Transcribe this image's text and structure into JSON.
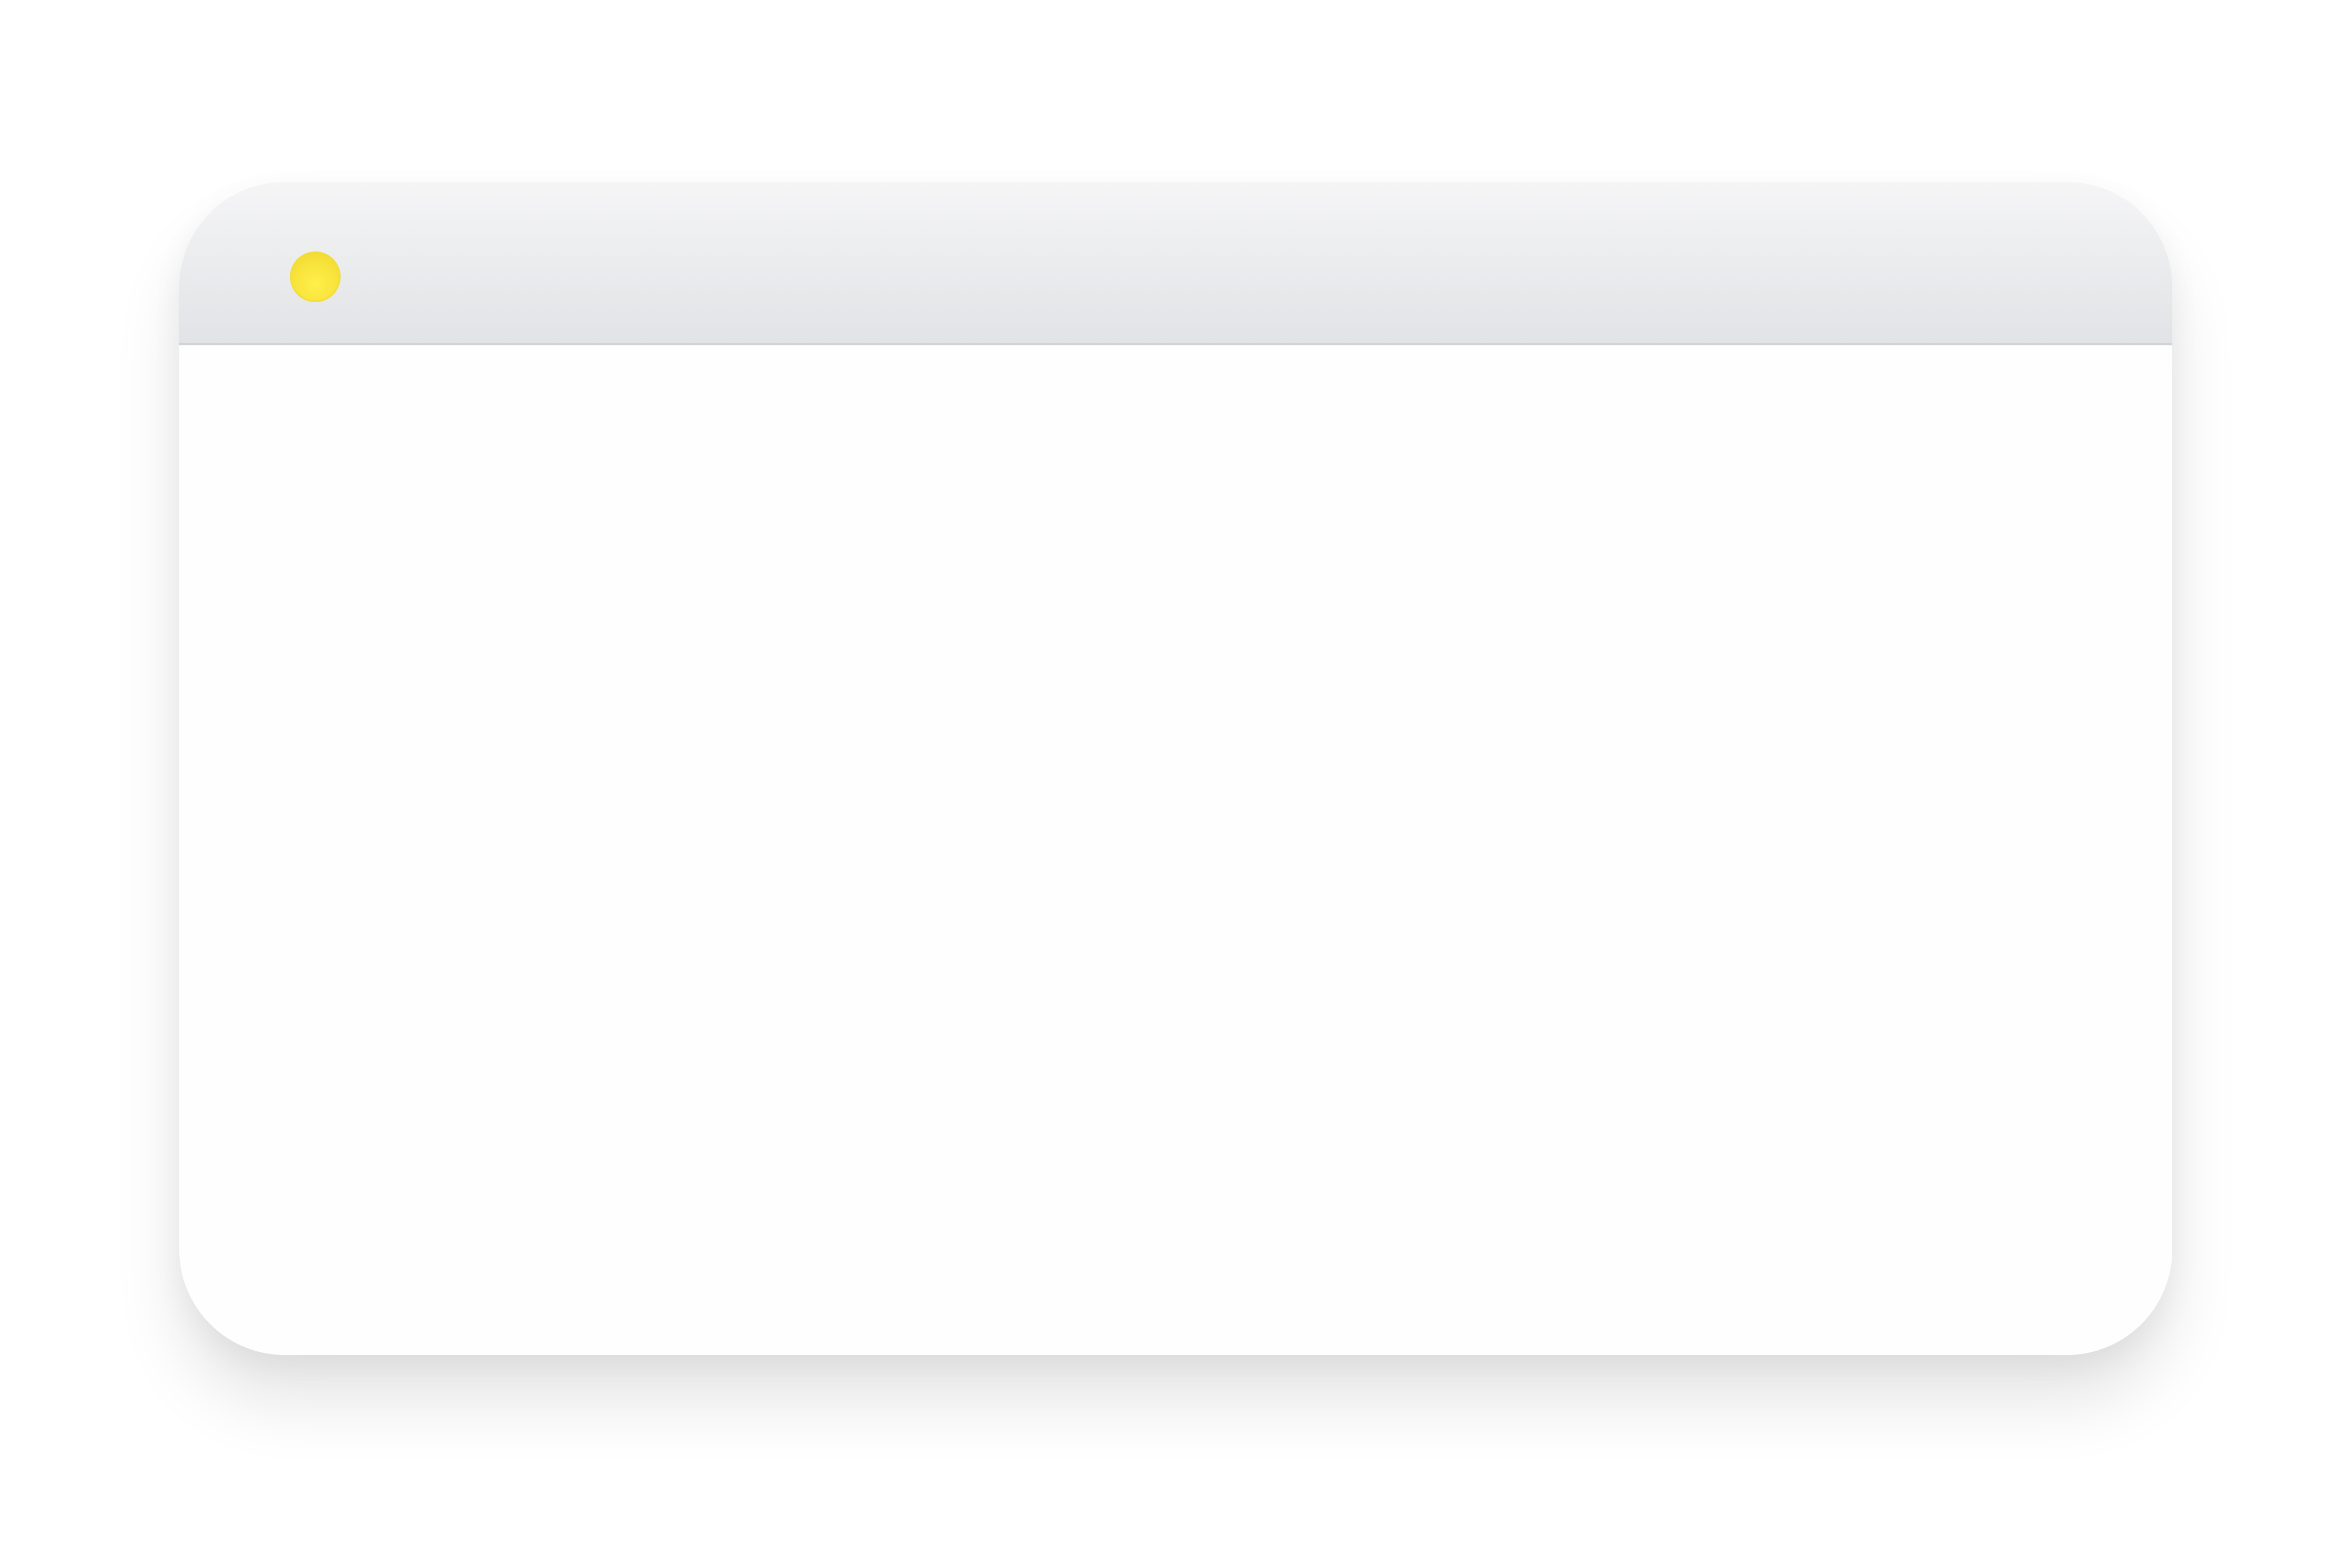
{
  "window": {
    "title": "",
    "controls": [
      {
        "name": "minimize",
        "icon": "yellow-circle-icon",
        "color": "#f7e23a"
      }
    ]
  },
  "content": {
    "text": ""
  }
}
